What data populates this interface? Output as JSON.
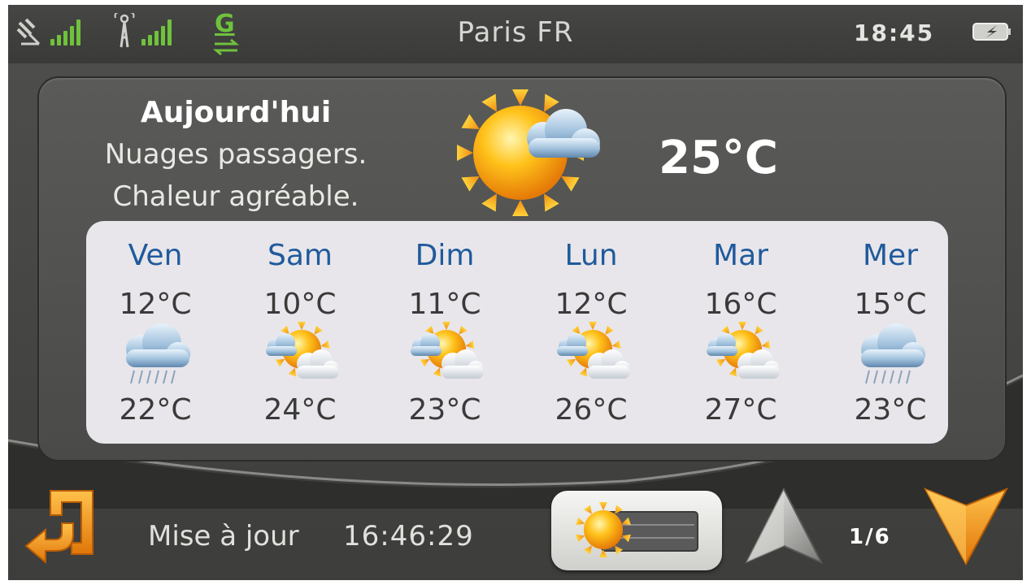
{
  "status_bar": {
    "city": "Paris  FR",
    "time": "18:45",
    "network_letter": "G",
    "icons": [
      "satellite-icon",
      "signal-icon",
      "antenna-icon",
      "signal-icon",
      "gprs-icon",
      "battery-charging-icon"
    ]
  },
  "today": {
    "title": "Aujourd'hui",
    "line1": "Nuages passagers.",
    "line2": "Chaleur agréable.",
    "temperature": "25°C",
    "icon": "sun-cloud-icon"
  },
  "forecast": [
    {
      "day": "Ven",
      "low": "12°C",
      "high": "22°C",
      "icon": "cloud-rain-icon"
    },
    {
      "day": "Sam",
      "low": "10°C",
      "high": "24°C",
      "icon": "sun-clouds-icon"
    },
    {
      "day": "Dim",
      "low": "11°C",
      "high": "23°C",
      "icon": "sun-clouds-icon"
    },
    {
      "day": "Lun",
      "low": "12°C",
      "high": "26°C",
      "icon": "sun-clouds-icon"
    },
    {
      "day": "Mar",
      "low": "16°C",
      "high": "27°C",
      "icon": "sun-clouds-icon"
    },
    {
      "day": "Mer",
      "low": "15°C",
      "high": "23°C",
      "icon": "cloud-rain-icon"
    }
  ],
  "footer": {
    "update_label": "Mise à jour",
    "update_time": "16:46:29",
    "page": "1/6"
  },
  "colors": {
    "background": "#4a4a48",
    "card": "#e8e6ea",
    "day_text": "#1f5a9c",
    "signal": "#6fc23c",
    "accent_orange": "#f39a1e"
  }
}
